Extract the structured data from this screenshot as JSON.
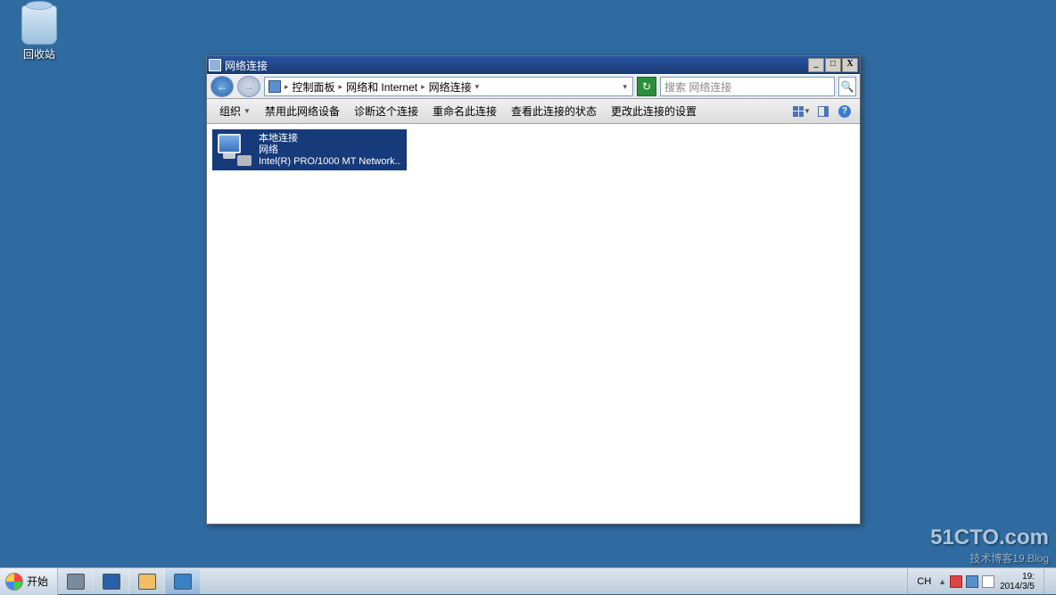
{
  "desktop": {
    "recycle_bin_label": "回收站"
  },
  "window": {
    "title": "网络连接",
    "breadcrumb": {
      "root_sep": " ▾ ",
      "part1": "控制面板",
      "part2": "网络和 Internet",
      "part3": "网络连接"
    },
    "search_placeholder": "搜索 网络连接",
    "toolbar": {
      "organize": "组织",
      "disable": "禁用此网络设备",
      "diagnose": "诊断这个连接",
      "rename": "重命名此连接",
      "status": "查看此连接的状态",
      "settings": "更改此连接的设置"
    },
    "item": {
      "name": "本地连接",
      "status": "网络",
      "adapter": "Intel(R) PRO/1000 MT Network..."
    }
  },
  "watermark": {
    "line1": "51CTO.com",
    "line2": "技术博客19.Blog"
  },
  "taskbar": {
    "start": "开始",
    "lang": "CH",
    "time": "19:",
    "date": "2014/3/5"
  }
}
